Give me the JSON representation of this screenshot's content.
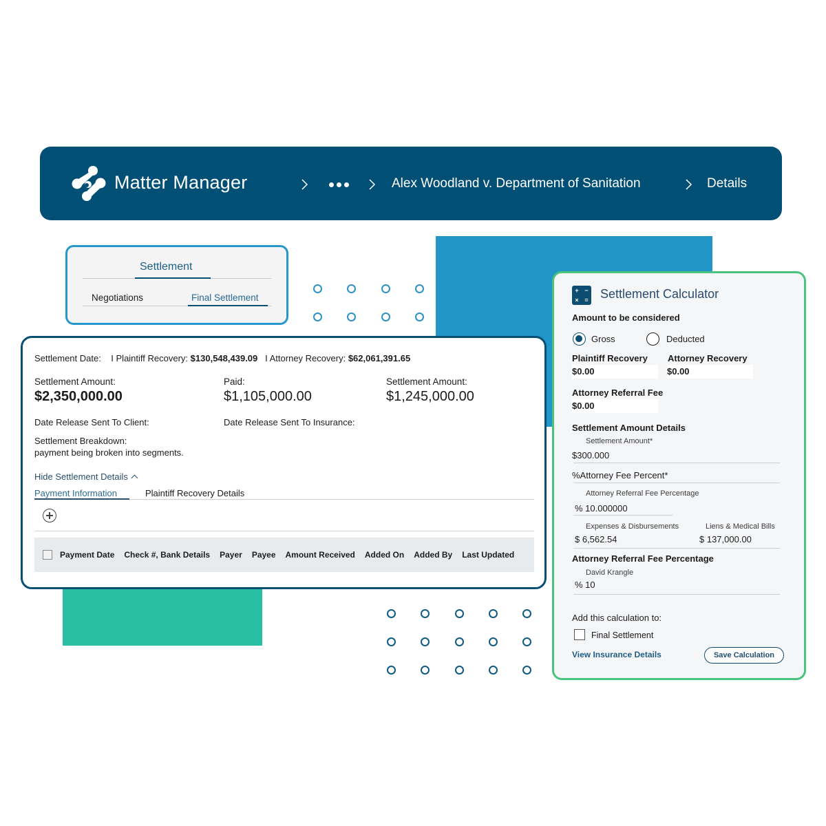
{
  "header": {
    "app_title": "Matter Manager",
    "breadcrumb": [
      {
        "label": "..."
      },
      {
        "label": "Alex Woodland v. Department of Sanitation"
      },
      {
        "label": "Details"
      }
    ]
  },
  "settlement_tabs": {
    "top_tab": "Settlement",
    "sub_tabs": [
      "Negotiations",
      "Final Settlement"
    ],
    "active_sub_tab": "Final Settlement"
  },
  "main": {
    "summary": {
      "date_label": "Settlement Date:",
      "plaintiff_label": "I Plaintiff Recovery:",
      "plaintiff_value": "$130,548,439.09",
      "attorney_label": "I Attorney Recovery:",
      "attorney_value": "$62,061,391.65"
    },
    "amounts": [
      {
        "label": "Settlement Amount:",
        "value": "$2,350,000.00"
      },
      {
        "label": "Paid:",
        "value": "$1,105,000.00"
      },
      {
        "label": "Settlement Amount:",
        "value": "$1,245,000.00"
      }
    ],
    "release_client_label": "Date Release Sent To Client:",
    "release_insurance_label": "Date Release Sent To Insurance:",
    "breakdown_label": "Settlement Breakdown:",
    "breakdown_value": "payment being broken into segments.",
    "hide_details": "Hide Settlement Details",
    "detail_tabs": [
      "Payment Information",
      "Plaintiff Recovery Details"
    ],
    "active_detail_tab": "Payment Information",
    "table_columns": [
      "Payment Date",
      "Check #, Bank Details",
      "Payer",
      "Payee",
      "Amount Received",
      "Added On",
      "Added By",
      "Last Updated"
    ]
  },
  "calculator": {
    "title": "Settlement Calculator",
    "icon_glyphs": [
      "+",
      "−",
      "×",
      "="
    ],
    "amount_label": "Amount to be considered",
    "options": [
      "Gross",
      "Deducted"
    ],
    "selected_option": "Gross",
    "plaintiff_recovery_label": "Plaintiff Recovery",
    "plaintiff_recovery_value": "$0.00",
    "attorney_recovery_label": "Attorney Recovery",
    "attorney_recovery_value": "$0.00",
    "referral_fee_label": "Attorney Referral Fee",
    "referral_fee_value": "$0.00",
    "details_heading": "Settlement Amount Details",
    "settlement_amount_label": "Settlement Amount*",
    "settlement_amount_value": "$300.000",
    "attorney_fee_percent_label": "%Attorney Fee Percent*",
    "referral_pct_label": "Attorney Referral Fee Percentage",
    "referral_pct_value": "% 10.000000",
    "expenses_label": "Expenses & Disbursements",
    "expenses_value": "$ 6,562.54",
    "liens_label": "Liens & Medical Bills",
    "liens_value": "$ 137,000.00",
    "referral_heading": "Attorney Referral Fee Percentage",
    "referral_person": "David Krangle",
    "referral_person_value": "% 10",
    "add_to_label": "Add this calculation to:",
    "add_to_option": "Final Settlement",
    "add_to_checked": false,
    "view_insurance_link": "View Insurance Details",
    "save_button": "Save Calculation"
  },
  "colors": {
    "header_bg": "#024f75",
    "accent_blue": "#2396c8",
    "accent_green": "#29bfa4",
    "calc_border": "#4cc27f",
    "main_border": "#084f74"
  }
}
